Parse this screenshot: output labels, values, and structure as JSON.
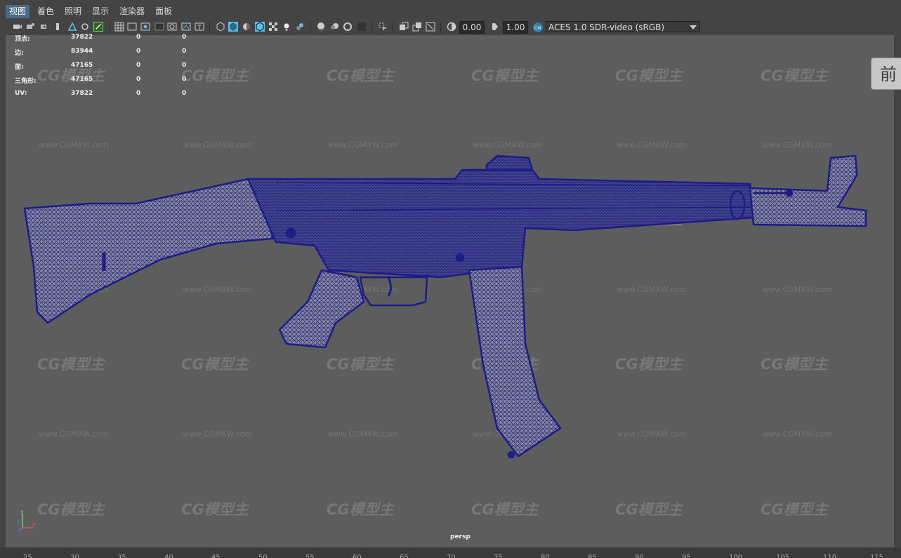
{
  "menubar": {
    "items": [
      "视图",
      "着色",
      "照明",
      "显示",
      "渲染器",
      "面板"
    ],
    "active_index": 0
  },
  "toolbar": {
    "exposure_value": "0.00",
    "gamma_value": "1.00",
    "color_transform": "ACES 1.0 SDR-video (sRGB)",
    "colors": {
      "accent": "#2f9fd6",
      "active_toggle": "#5ec0e8",
      "frame_green": "#6cd56c"
    }
  },
  "hud": {
    "rows": [
      {
        "label": "顶点:",
        "v1": "37822",
        "v2": "0",
        "v3": "0"
      },
      {
        "label": "边:",
        "v1": "83944",
        "v2": "0",
        "v3": "0"
      },
      {
        "label": "面:",
        "v1": "47165",
        "v2": "0",
        "v3": "0"
      },
      {
        "label": "三角形:",
        "v1": "47165",
        "v2": "0",
        "v3": "0"
      },
      {
        "label": "UV:",
        "v1": "37822",
        "v2": "0",
        "v3": "0"
      }
    ]
  },
  "viewport": {
    "camera": "persp",
    "viewcube_face": "前",
    "background_color": "#5d5d5d",
    "wireframe_color": "#1c1c86",
    "shaded_color": "#888888",
    "axis": {
      "y": "y",
      "z": "z",
      "x": "x"
    }
  },
  "watermark": {
    "logo_text": "CG模型主",
    "url_text": "www.CGMXW.com"
  },
  "ruler": {
    "ticks": [
      "25",
      "30",
      "35",
      "40",
      "45",
      "50",
      "55",
      "60",
      "65",
      "70",
      "75",
      "80",
      "85",
      "90",
      "95",
      "100",
      "105",
      "110",
      "115"
    ]
  }
}
